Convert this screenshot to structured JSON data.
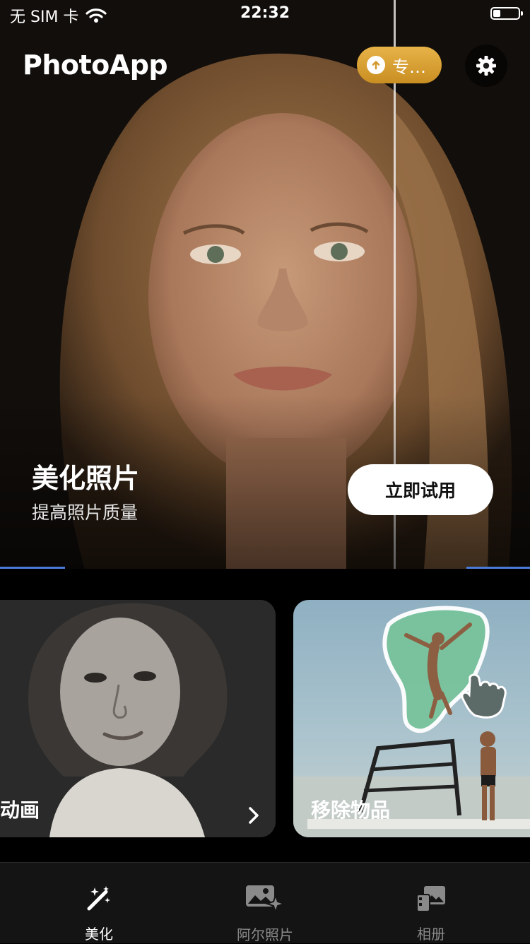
{
  "status_bar": {
    "carrier": "无 SIM 卡",
    "time": "22:32"
  },
  "header": {
    "app_title": "PhotoApp",
    "pro_label": "专…"
  },
  "hero": {
    "title": "美化照片",
    "subtitle": "提高照片质量",
    "cta_label": "立即试用"
  },
  "cards": [
    {
      "label": "动画"
    },
    {
      "label": "移除物品"
    }
  ],
  "tabs": [
    {
      "label": "美化",
      "icon": "magic-wand-icon",
      "active": true
    },
    {
      "label": "阿尔照片",
      "icon": "ai-photo-icon",
      "active": false
    },
    {
      "label": "相册",
      "icon": "album-icon",
      "active": false
    }
  ],
  "colors": {
    "pro_gold": "#d9a23a",
    "accent_blue": "#4a7bd8",
    "tab_bar_bg": "#141414"
  }
}
